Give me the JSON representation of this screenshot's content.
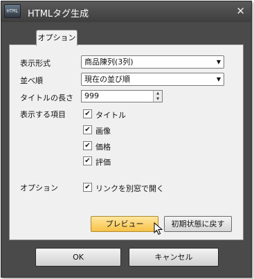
{
  "window": {
    "title": "HTMLタグ生成",
    "app_icon_text": "HTML",
    "close_glyph": "✕"
  },
  "tabs": [
    {
      "label": "オプション"
    }
  ],
  "form": {
    "display_format": {
      "label": "表示形式",
      "value": "商品陳列(3列)"
    },
    "sort_order": {
      "label": "並べ順",
      "value": "現在の並び順"
    },
    "title_length": {
      "label": "タイトルの長さ",
      "value": "999"
    },
    "display_items": {
      "label": "表示する項目",
      "items": [
        {
          "label": "タイトル",
          "checked": true
        },
        {
          "label": "画像",
          "checked": true
        },
        {
          "label": "価格",
          "checked": true
        },
        {
          "label": "評価",
          "checked": true
        }
      ]
    },
    "options": {
      "label": "オプション",
      "checkbox_label": "リンクを別窓で開く",
      "checked": true
    }
  },
  "buttons": {
    "preview": "プレビュー",
    "reset": "初期状態に戻す",
    "ok": "OK",
    "cancel": "キャンセル"
  },
  "icons": {
    "dropdown": "▼",
    "spin_up": "▲",
    "spin_down": "▼",
    "check": "✔"
  }
}
